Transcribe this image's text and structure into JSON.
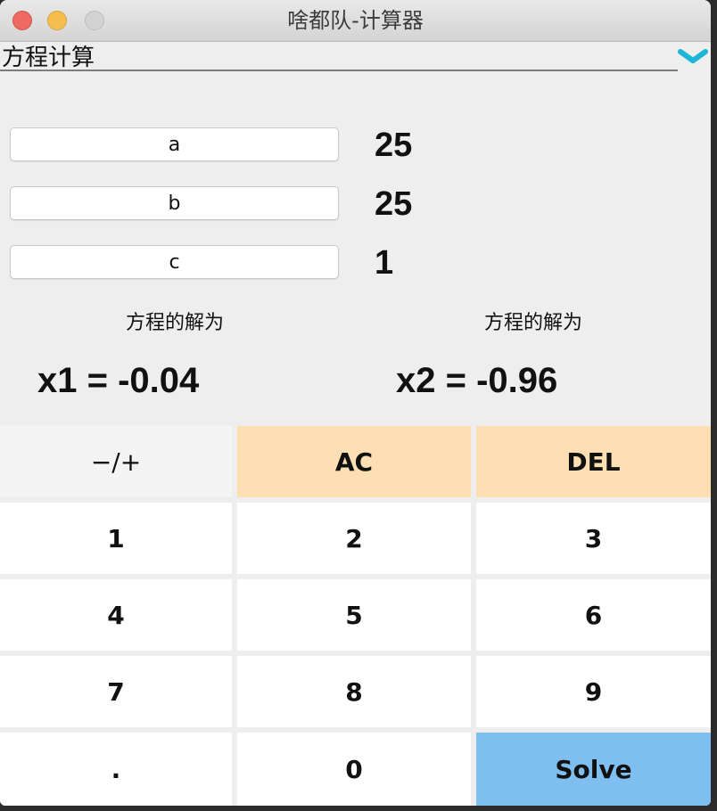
{
  "window": {
    "title": "啥都队-计算器"
  },
  "mode_selector": {
    "value": "方程计算",
    "icon": "chevron-down-icon",
    "icon_color": "#1eb6d8"
  },
  "params": [
    {
      "name": "a",
      "value": "25"
    },
    {
      "name": "b",
      "value": "25"
    },
    {
      "name": "c",
      "value": "1"
    }
  ],
  "solutions": {
    "label1": "方程的解为",
    "value1": "x1 = -0.04",
    "label2": "方程的解为",
    "value2": "x2 = -0.96"
  },
  "keypad": {
    "sign": "−/+",
    "ac": "AC",
    "del": "DEL",
    "d1": "1",
    "d2": "2",
    "d3": "3",
    "d4": "4",
    "d5": "5",
    "d6": "6",
    "d7": "7",
    "d8": "8",
    "d9": "9",
    "dot": ".",
    "d0": "0",
    "solve": "Solve"
  },
  "colors": {
    "accent_orange": "#fedfb3",
    "accent_blue": "#7fbfef"
  }
}
